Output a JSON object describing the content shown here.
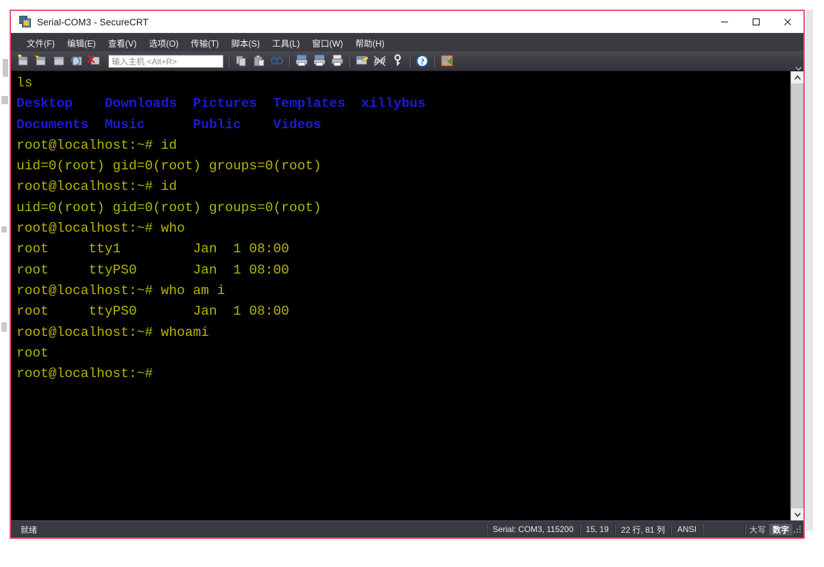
{
  "window": {
    "title": "Serial-COM3 - SecureCRT",
    "icon": "securecrt-app-icon",
    "controls": {
      "minimize": "minimize-icon",
      "maximize": "maximize-icon",
      "close": "close-icon"
    }
  },
  "menubar": {
    "items": [
      {
        "label": "文件(F)",
        "name": "menu-file"
      },
      {
        "label": "编辑(E)",
        "name": "menu-edit"
      },
      {
        "label": "查看(V)",
        "name": "menu-view"
      },
      {
        "label": "选项(O)",
        "name": "menu-options"
      },
      {
        "label": "传输(T)",
        "name": "menu-transfer"
      },
      {
        "label": "脚本(S)",
        "name": "menu-script"
      },
      {
        "label": "工具(L)",
        "name": "menu-tools"
      },
      {
        "label": "窗口(W)",
        "name": "menu-window"
      },
      {
        "label": "帮助(H)",
        "name": "menu-help"
      }
    ]
  },
  "toolbar": {
    "host_placeholder": "输入主机 <Alt+R>",
    "host_value": "",
    "icons": [
      "new-session-icon",
      "connect-icon",
      "connect-local-shell-icon",
      "reconnect-icon",
      "disconnect-icon",
      "copy-icon",
      "paste-icon",
      "find-icon",
      "print-icon",
      "print-selection-icon",
      "printer-icon",
      "session-options-icon",
      "chat-window-icon",
      "key-icon",
      "help-icon",
      "transfer-window-icon"
    ]
  },
  "terminal": {
    "lines": [
      {
        "segments": [
          {
            "text": "ls",
            "color": "yellow"
          }
        ]
      },
      {
        "segments": [
          {
            "text": "Desktop    Downloads  Pictures  Templates  xillybus",
            "color": "blue"
          }
        ]
      },
      {
        "segments": [
          {
            "text": "Documents  Music      Public    Videos",
            "color": "blue"
          }
        ]
      },
      {
        "segments": [
          {
            "text": "root@localhost:~# id",
            "color": "yellow"
          }
        ]
      },
      {
        "segments": [
          {
            "text": "uid=0(root) gid=0(root) groups=0(root)",
            "color": "yellow"
          }
        ]
      },
      {
        "segments": [
          {
            "text": "root@localhost:~# id",
            "color": "yellow"
          }
        ]
      },
      {
        "segments": [
          {
            "text": "uid=0(root) gid=0(root) groups=0(root)",
            "color": "yellow"
          }
        ]
      },
      {
        "segments": [
          {
            "text": "root@localhost:~# who",
            "color": "yellow"
          }
        ]
      },
      {
        "segments": [
          {
            "text": "root     tty1         Jan  1 08:00",
            "color": "yellow"
          }
        ]
      },
      {
        "segments": [
          {
            "text": "root     ttyPS0       Jan  1 08:00",
            "color": "yellow"
          }
        ]
      },
      {
        "segments": [
          {
            "text": "root@localhost:~# who am i",
            "color": "yellow"
          }
        ]
      },
      {
        "segments": [
          {
            "text": "root     ttyPS0       Jan  1 08:00",
            "color": "yellow"
          }
        ]
      },
      {
        "segments": [
          {
            "text": "root@localhost:~# whoami",
            "color": "yellow"
          }
        ]
      },
      {
        "segments": [
          {
            "text": "root",
            "color": "yellow"
          }
        ]
      },
      {
        "segments": [
          {
            "text": "root@localhost:~#",
            "color": "yellow"
          }
        ]
      }
    ],
    "colors": {
      "background": "#000000",
      "yellow": "#b5b500",
      "blue": "#1b1bd2"
    }
  },
  "statusbar": {
    "ready": "就绪",
    "serial": "Serial: COM3, 115200",
    "cursor": "15, 19",
    "size": "22 行, 81 列",
    "emulation": "ANSI",
    "caps": "大写",
    "num": "数字"
  }
}
